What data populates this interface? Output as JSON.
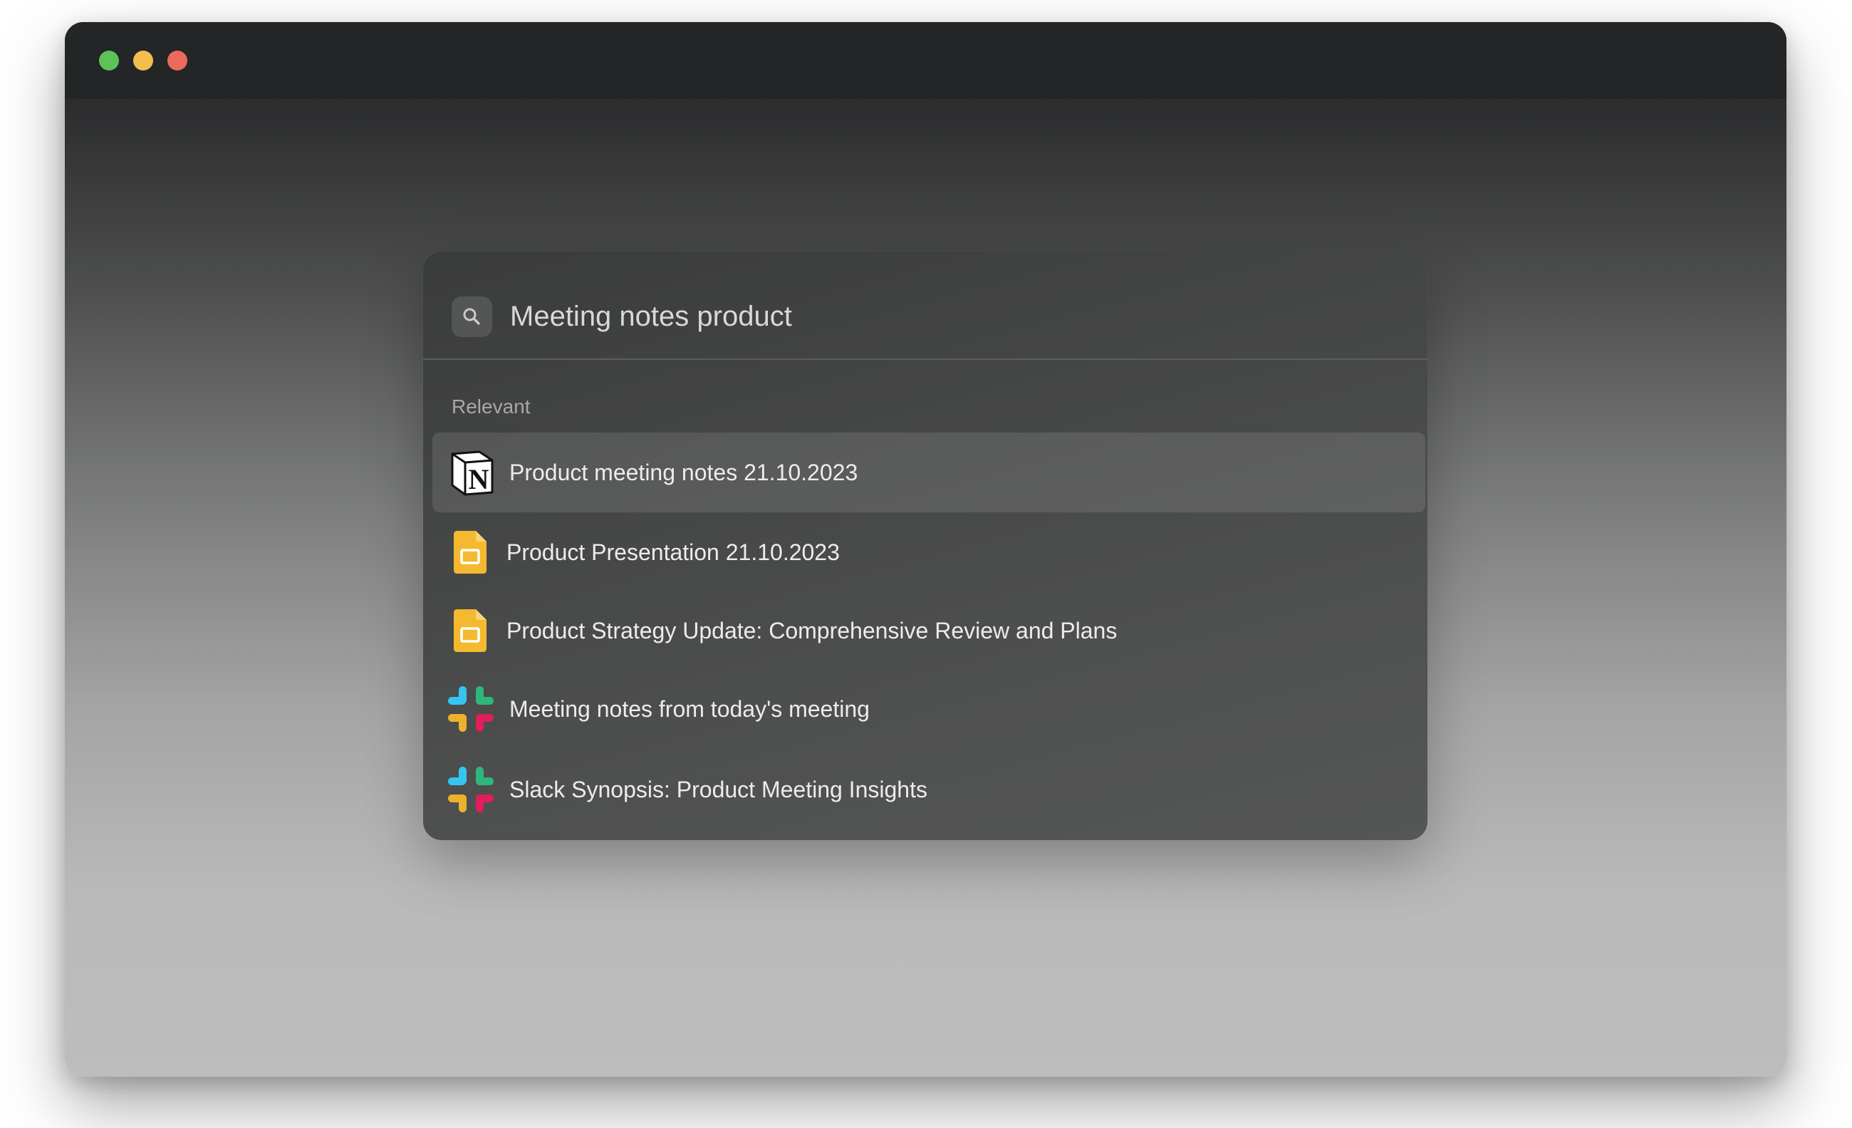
{
  "search": {
    "query": "Meeting notes product"
  },
  "section": {
    "label": "Relevant"
  },
  "results": [
    {
      "label": "Product meeting notes 21.10.2023",
      "icon": "notion-icon",
      "selected": true
    },
    {
      "label": "Product Presentation 21.10.2023",
      "icon": "google-slides-icon",
      "selected": false
    },
    {
      "label": "Product Strategy Update: Comprehensive Review and Plans",
      "icon": "google-slides-icon",
      "selected": false
    },
    {
      "label": "Meeting notes from today's meeting",
      "icon": "slack-icon",
      "selected": false
    },
    {
      "label": "Slack Synopsis: Product Meeting Insights",
      "icon": "slack-icon",
      "selected": false
    }
  ],
  "colors": {
    "traffic_green": "#5dc356",
    "traffic_yellow": "#f4be4f",
    "traffic_red": "#eb6a5c",
    "slides_yellow": "#f4b92f",
    "selected_row": "rgba(255,255,255,0.11)"
  }
}
